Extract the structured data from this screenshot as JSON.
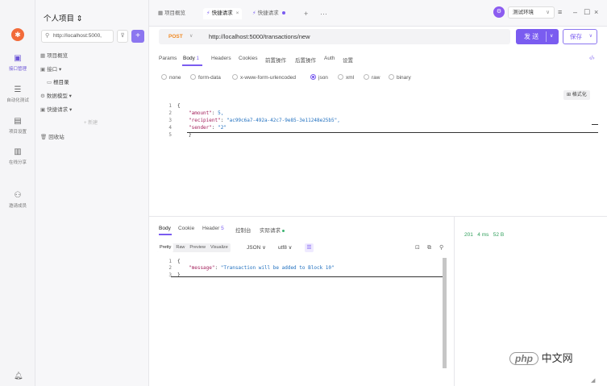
{
  "rail": {
    "items": [
      {
        "label": "接口管理",
        "icon": "api-icon"
      },
      {
        "label": "自动化测试",
        "icon": "automation-icon"
      },
      {
        "label": "项目设置",
        "icon": "settings-icon"
      },
      {
        "label": "在线分享",
        "icon": "share-icon"
      },
      {
        "label": "邀请成员",
        "icon": "invite-icon"
      }
    ]
  },
  "sidebar": {
    "title": "个人项目 ⇕",
    "search_value": "http://localhost:5000,",
    "tree": [
      {
        "label": "项目概览"
      },
      {
        "label": "接口 ▾"
      },
      {
        "label": "根目录"
      },
      {
        "label": "数据模型 ▾"
      },
      {
        "label": "快捷请求 ▾"
      },
      {
        "label": "+ 新建"
      },
      {
        "label": "回收站"
      }
    ]
  },
  "tabs": [
    {
      "label": "项目概览"
    },
    {
      "label": "快捷请求"
    },
    {
      "label": "快捷请求"
    }
  ],
  "env": {
    "label": "测试环境"
  },
  "request": {
    "method": "POST",
    "url": "http://localhost:5000/transactions/new",
    "send_label": "发 送",
    "save_label": "保存",
    "subtabs": [
      "Params",
      "Body",
      "Headers",
      "Cookies",
      "前置操作",
      "后置操作",
      "Auth",
      "设置"
    ],
    "body_count": "1",
    "body_types": [
      "none",
      "form-data",
      "x-www-form-urlencoded",
      "json",
      "xml",
      "raw",
      "binary"
    ],
    "selected_body_type": "json",
    "format_label": "格式化",
    "code_lines": [
      {
        "num": "1",
        "text": "{"
      },
      {
        "num": "2",
        "key": "\"amount\"",
        "val": " 5,"
      },
      {
        "num": "3",
        "key": "\"recipient\"",
        "val": " \"ac99c6a7-492a-42c7-9e85-3e11248e25b5\","
      },
      {
        "num": "4",
        "key": "\"sender\"",
        "val": " \"2\""
      },
      {
        "num": "5",
        "text": "}"
      }
    ]
  },
  "response": {
    "tabs": [
      "Body",
      "Cookie",
      "Header",
      "控制台",
      "实际请求"
    ],
    "header_count": "5",
    "status": "201",
    "time": "4 ms",
    "size": "52 B",
    "views": [
      "Pretty",
      "Raw",
      "Preview",
      "Visualize"
    ],
    "format": "JSON",
    "encoding": "utf8",
    "code_lines": [
      {
        "num": "1",
        "text": "{"
      },
      {
        "num": "2",
        "key": "\"message\"",
        "val": " \"Transaction will be added to Block 10\""
      },
      {
        "num": "3",
        "text": "}"
      }
    ]
  },
  "watermark": {
    "logo": "php",
    "text": "中文网"
  }
}
